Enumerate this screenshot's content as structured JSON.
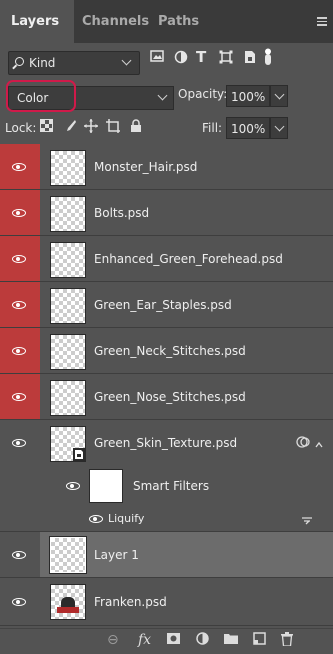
{
  "tabs": {
    "layers": "Layers",
    "channels": "Channels",
    "paths": "Paths"
  },
  "filter": {
    "kind": "Kind"
  },
  "blend": {
    "mode": "Color",
    "opacity_label": "Opacity:",
    "opacity_value": "100%"
  },
  "lock": {
    "label": "Lock:",
    "fill_label": "Fill:",
    "fill_value": "100%"
  },
  "layers": [
    {
      "name": "Monster_Hair.psd"
    },
    {
      "name": "Bolts.psd"
    },
    {
      "name": "Enhanced_Green_Forehead.psd"
    },
    {
      "name": "Green_Ear_Staples.psd"
    },
    {
      "name": "Green_Neck_Stitches.psd"
    },
    {
      "name": "Green_Nose_Stitches.psd"
    },
    {
      "name": "Green_Skin_Texture.psd"
    },
    {
      "name": "Layer 1"
    },
    {
      "name": "Franken.psd"
    }
  ],
  "smart_filters": {
    "label": "Smart Filters",
    "liquify": "Liquify"
  },
  "bottom": {
    "link": "⊖",
    "fx": "fx"
  }
}
